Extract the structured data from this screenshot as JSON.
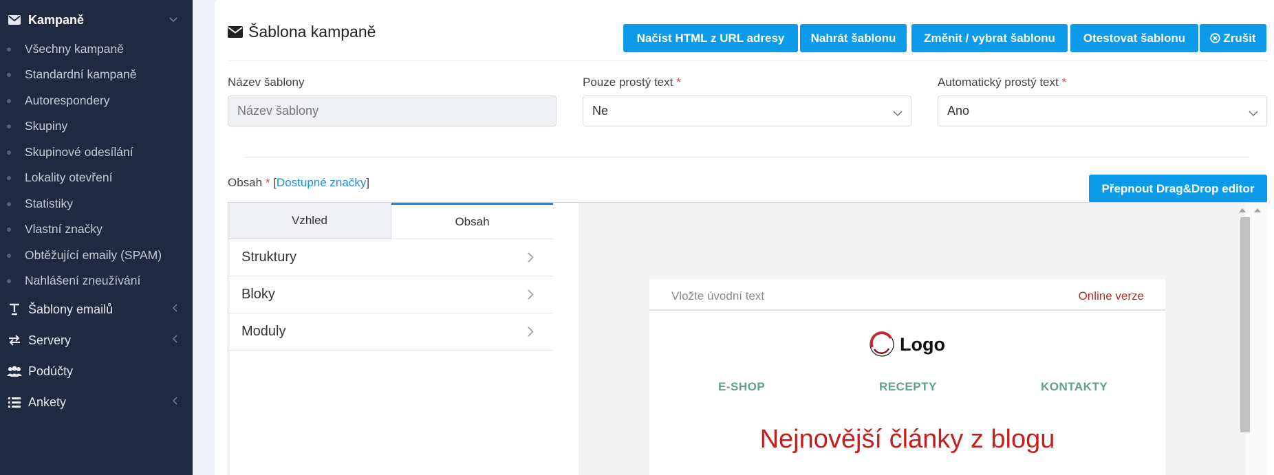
{
  "sidebar": {
    "campaigns": {
      "label": "Kampaně",
      "icon": "envelope-icon"
    },
    "items": [
      {
        "label": "Všechny kampaně"
      },
      {
        "label": "Standardní kampaně"
      },
      {
        "label": "Autorespondery"
      },
      {
        "label": "Skupiny"
      },
      {
        "label": "Skupinové odesílání"
      },
      {
        "label": "Lokality otevření"
      },
      {
        "label": "Statistiky"
      },
      {
        "label": "Vlastní značky"
      },
      {
        "label": "Obtěžující emaily (SPAM)"
      },
      {
        "label": "Nahlášení zneužívání"
      }
    ],
    "templates": {
      "label": "Šablony emailů",
      "icon": "text-format-icon"
    },
    "servers": {
      "label": "Servery",
      "icon": "transfer-arrows-icon"
    },
    "subaccounts": {
      "label": "Podúčty",
      "icon": "users-icon"
    },
    "surveys": {
      "label": "Ankety",
      "icon": "list-icon"
    }
  },
  "header": {
    "title": "Šablona kampaně",
    "buttons": {
      "load_html": "Načíst HTML z URL adresy",
      "upload": "Nahrát šablonu",
      "change": "Změnit / vybrat šablonu",
      "test": "Otestovat šablonu",
      "cancel": "Zrušit"
    }
  },
  "form": {
    "name": {
      "label": "Název šablony",
      "placeholder": "Název šablony"
    },
    "plain_only": {
      "label": "Pouze prostý text",
      "required": "*",
      "value": "Ne"
    },
    "auto_plain": {
      "label": "Automatický prostý text",
      "required": "*",
      "value": "Ano"
    }
  },
  "content": {
    "label": "Obsah",
    "required": "*",
    "open_bracket": "[",
    "tags_link": "Dostupné značky",
    "close_bracket": "]",
    "dragdrop_button": "Přepnout Drag&Drop editor"
  },
  "editor": {
    "tabs": {
      "appearance": "Vzhled",
      "content": "Obsah"
    },
    "sections": [
      {
        "label": "Struktury"
      },
      {
        "label": "Bloky"
      },
      {
        "label": "Moduly"
      }
    ],
    "preview": {
      "intro": "Vložte úvodní text",
      "online": "Online verze",
      "logo": "Logo",
      "nav": [
        "E-SHOP",
        "RECEPTY",
        "KONTAKTY"
      ],
      "headline": "Nejnovější články z blogu"
    }
  },
  "colors": {
    "sidebar_bg": "#1e2a3f",
    "primary_button": "#0b9be8",
    "required": "#e14b4b",
    "link": "#1d8fd8",
    "headline": "#c41e1e",
    "nav_green": "#5f9f8f"
  }
}
